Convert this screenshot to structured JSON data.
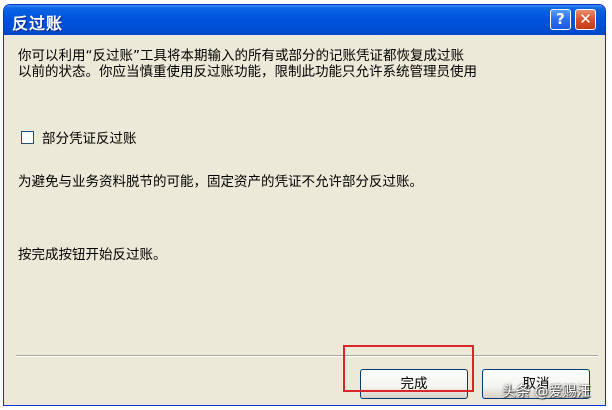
{
  "dialog": {
    "title": "反过账",
    "help_label": "?",
    "close_label": "✕",
    "intro_line1": "你可以利用“反过账”工具将本期输入的所有或部分的记账凭证都恢复成过账",
    "intro_line2": "以前的状态。你应当慎重使用反过账功能，限制此功能只允许系统管理员使用",
    "checkbox_label": "部分凭证反过账",
    "checkbox_checked": false,
    "note": "为避免与业务资料脱节的可能，固定资产的凭证不允许部分反过账。",
    "instruction": "按完成按钮开始反过账。",
    "finish_label": "完成",
    "cancel_label": "取消"
  },
  "overlay": {
    "watermark": "头条 @爱赐汪",
    "highlight_color": "#d9262b"
  },
  "colors": {
    "titlebar": "#0053de",
    "dialog_bg": "#ece9d8"
  }
}
